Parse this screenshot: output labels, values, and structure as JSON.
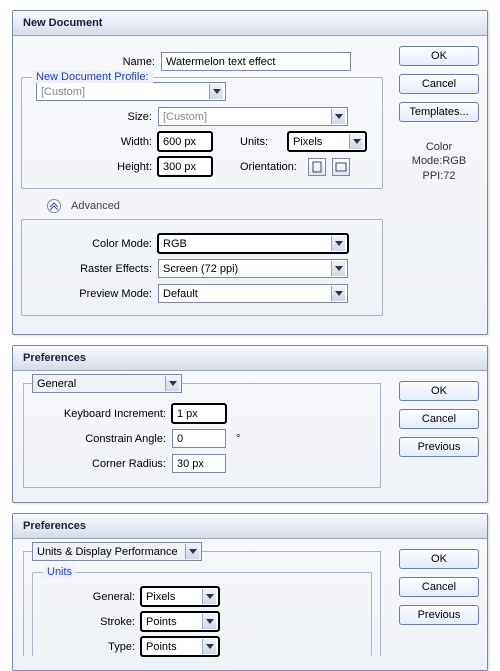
{
  "newdoc": {
    "title": "New Document",
    "profile_group_label": "New Document Profile:",
    "name_label": "Name:",
    "name_value": "Watermelon text effect",
    "profile_value": "[Custom]",
    "size_label": "Size:",
    "size_value": "[Custom]",
    "width_label": "Width:",
    "width_value": "600 px",
    "height_label": "Height:",
    "height_value": "300 px",
    "units_label": "Units:",
    "units_value": "Pixels",
    "orientation_label": "Orientation:",
    "advanced_label": "Advanced",
    "colormode_label": "Color Mode:",
    "colormode_value": "RGB",
    "raster_label": "Raster Effects:",
    "raster_value": "Screen (72 ppi)",
    "preview_label": "Preview Mode:",
    "preview_value": "Default",
    "ok": "OK",
    "cancel": "Cancel",
    "templates": "Templates...",
    "info1": "Color Mode:RGB",
    "info2": "PPI:72"
  },
  "prefs1": {
    "title": "Preferences",
    "section": "General",
    "ki_label": "Keyboard Increment:",
    "ki_value": "1 px",
    "ca_label": "Constrain Angle:",
    "ca_value": "0",
    "cr_label": "Corner Radius:",
    "cr_value": "30 px",
    "ok": "OK",
    "cancel": "Cancel",
    "previous": "Previous"
  },
  "prefs2": {
    "title": "Preferences",
    "section": "Units & Display Performance",
    "units_group": "Units",
    "general_label": "General:",
    "general_value": "Pixels",
    "stroke_label": "Stroke:",
    "stroke_value": "Points",
    "type_label": "Type:",
    "type_value": "Points",
    "ok": "OK",
    "cancel": "Cancel",
    "previous": "Previous"
  }
}
